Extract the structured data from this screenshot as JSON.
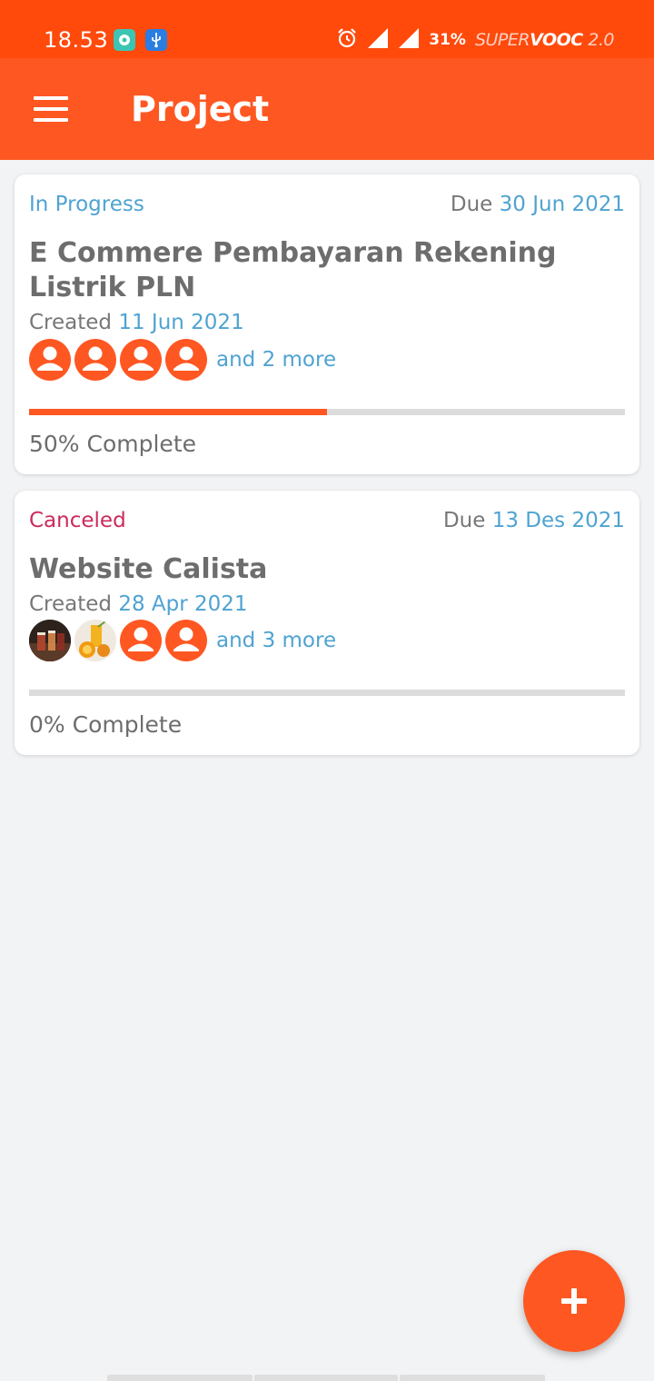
{
  "status_bar": {
    "time": "18.53",
    "battery": "31%",
    "charging_brand_1": "SUPER",
    "charging_brand_2": "VOOC",
    "charging_brand_3": "2.0",
    "icons": [
      "pill-app-icon",
      "usb-icon",
      "alarm-icon",
      "signal-icon",
      "signal-icon"
    ]
  },
  "app_bar": {
    "title": "Project",
    "menu_icon": "hamburger-menu-icon"
  },
  "projects": [
    {
      "status": "In Progress",
      "status_color": "#4fa3d1",
      "due_label": "Due",
      "due_date": "30 Jun 2021",
      "title": "E Commere Pembayaran Rekening Listrik PLN",
      "created_label": "Created",
      "created_date": "11 Jun 2021",
      "members": [
        "person-icon",
        "person-icon",
        "person-icon",
        "person-icon"
      ],
      "more": "and 2 more",
      "progress": 0.5,
      "complete_text": "50% Complete"
    },
    {
      "status": "Canceled",
      "status_color": "#cc2a5a",
      "due_label": "Due",
      "due_date": "13 Des 2021",
      "title": "Website Calista",
      "created_label": "Created",
      "created_date": "28 Apr 2021",
      "members": [
        "photo-avatar-drinks",
        "photo-avatar-juice",
        "person-icon",
        "person-icon"
      ],
      "more": "and 3 more",
      "progress": 0,
      "complete_text": "0% Complete"
    }
  ],
  "fab": {
    "icon": "plus-icon"
  },
  "colors": {
    "status_bar": "#ff4a0c",
    "app_bar": "#ff5722",
    "accent": "#ff5722",
    "link": "#4fa3d1",
    "background": "#f2f3f5"
  }
}
